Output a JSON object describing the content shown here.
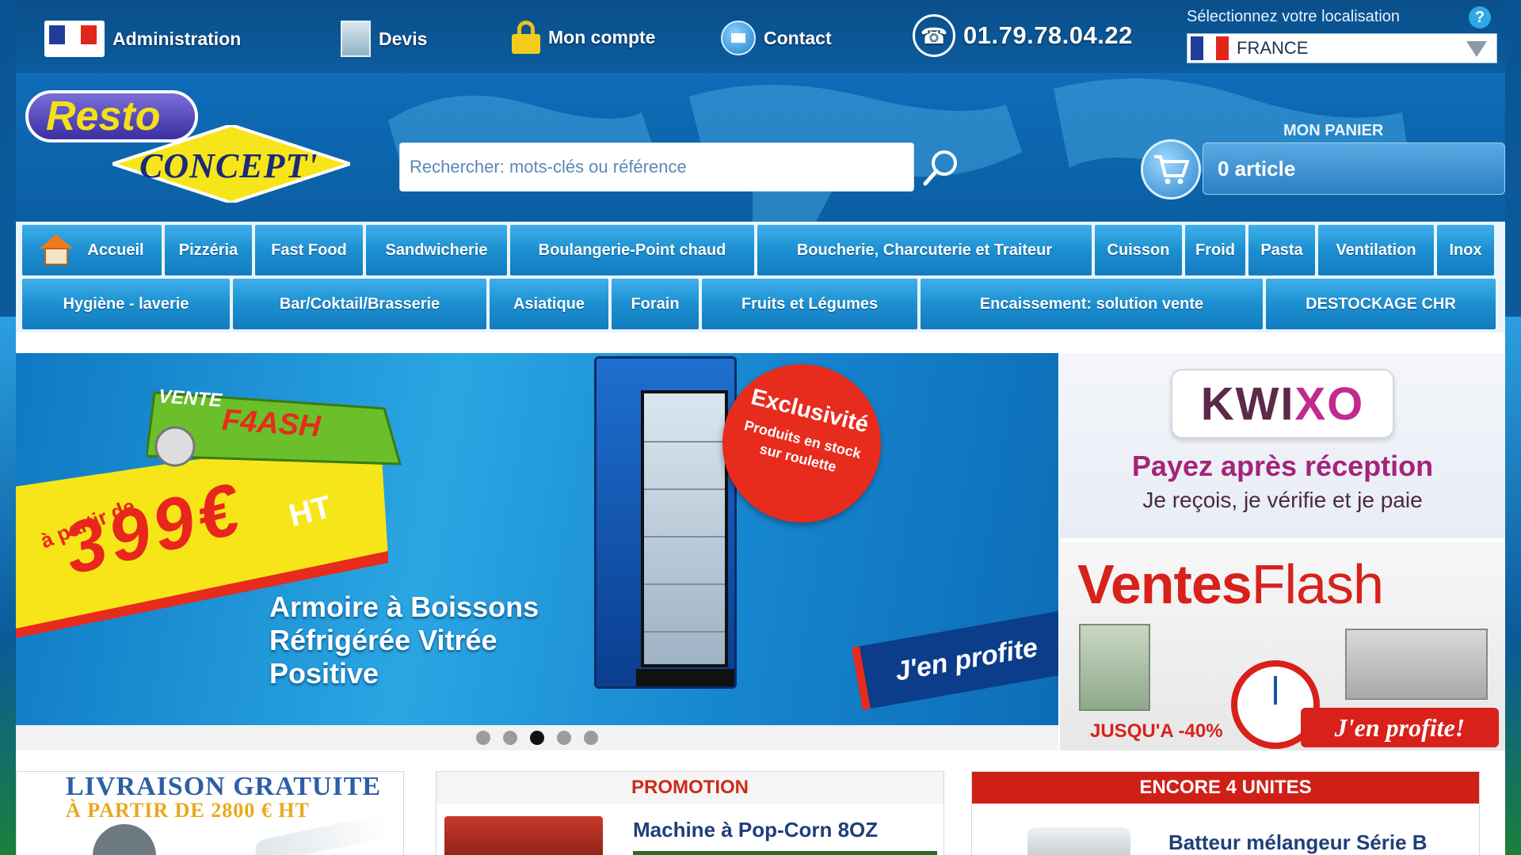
{
  "topbar": {
    "admin_label": "Administration",
    "devis_label": "Devis",
    "account_label": "Mon compte",
    "contact_label": "Contact",
    "phone": "01.79.78.04.22",
    "location_label": "Sélectionnez votre localisation",
    "location_value": "FRANCE"
  },
  "header": {
    "logo_resto": "Resto",
    "logo_concept": "CONCEPT'",
    "search_placeholder": "Rechercher: mots-clés ou référence",
    "cart_title": "MON PANIER",
    "cart_value": "0 article"
  },
  "nav": {
    "row1": [
      "Accueil",
      "Pizzéria",
      "Fast Food",
      "Sandwicherie",
      "Boulangerie-Point chaud",
      "Boucherie, Charcuterie et Traiteur",
      "Cuisson",
      "Froid",
      "Pasta",
      "Ventilation",
      "Inox"
    ],
    "row2": [
      "Hygiène - laverie",
      "Bar/Coktail/Brasserie",
      "Asiatique",
      "Forain",
      "Fruits et Légumes",
      "Encaissement: solution vente",
      "DESTOCKAGE CHR"
    ]
  },
  "banner": {
    "vente": "VENTE",
    "flash": "F4ASH",
    "from": "à partir de",
    "price": "399€",
    "ht": "HT",
    "line1": "Armoire à Boissons",
    "line2": "Réfrigérée Vitrée",
    "line3": "Positive",
    "badge_title": "Exclusivité",
    "badge_text": "Produits en stock sur roulette",
    "cta": "J'en profite",
    "active_slide": 3,
    "slide_count": 5
  },
  "kwixo": {
    "brand_a": "KWI",
    "brand_b": "XO",
    "line1": "Payez après réception",
    "line2": "Je reçois, je vérifie et je paie"
  },
  "ventes_flash": {
    "title_a": "Ventes",
    "title_b": "Flash",
    "discount": "JUSQU'A -40%",
    "cta": "J'en profite!"
  },
  "cards": {
    "delivery_l1": "LIVRAISON GRATUITE",
    "delivery_l2": "À PARTIR DE 2800 € HT",
    "promo_header": "PROMOTION",
    "promo_product": "Machine à Pop-Corn 8OZ",
    "stock_header": "ENCORE 4 UNITES",
    "stock_product": "Batteur mélangeur Série B"
  },
  "colors": {
    "nav_blue": "#1c8fd0",
    "accent_red": "#cf2018",
    "kwixo_purple": "#a5237a",
    "brand_yellow": "#f4e01a"
  }
}
